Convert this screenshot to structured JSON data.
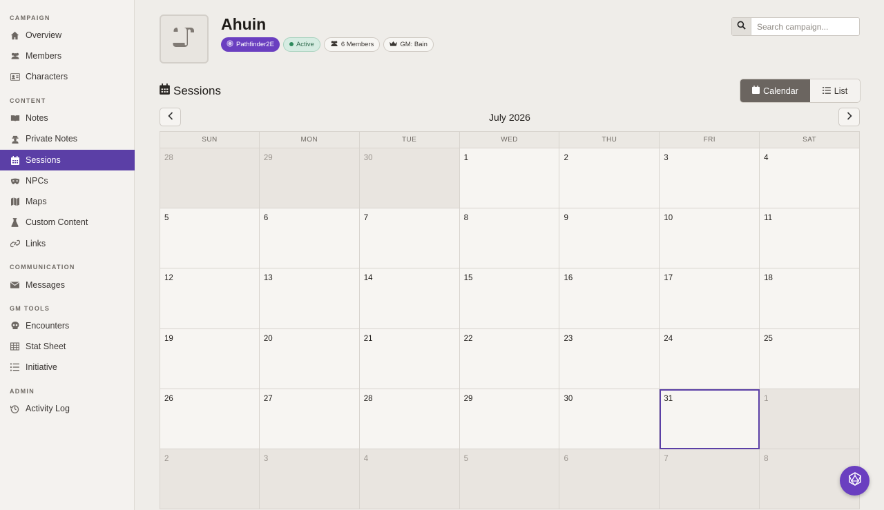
{
  "sidebar": {
    "sections": [
      {
        "title": "CAMPAIGN"
      },
      {
        "title": "CONTENT"
      },
      {
        "title": "COMMUNICATION"
      },
      {
        "title": "GM TOOLS"
      },
      {
        "title": "ADMIN"
      }
    ],
    "items": [
      {
        "label": "Overview",
        "icon": "home-icon"
      },
      {
        "label": "Members",
        "icon": "users-icon"
      },
      {
        "label": "Characters",
        "icon": "id-card-icon"
      },
      {
        "label": "Notes",
        "icon": "book-icon"
      },
      {
        "label": "Private Notes",
        "icon": "user-secret-icon"
      },
      {
        "label": "Sessions",
        "icon": "calendar-icon",
        "active": true
      },
      {
        "label": "NPCs",
        "icon": "mask-icon"
      },
      {
        "label": "Maps",
        "icon": "map-icon"
      },
      {
        "label": "Custom Content",
        "icon": "flask-icon"
      },
      {
        "label": "Links",
        "icon": "link-icon"
      },
      {
        "label": "Messages",
        "icon": "envelope-icon"
      },
      {
        "label": "Encounters",
        "icon": "skull-icon"
      },
      {
        "label": "Stat Sheet",
        "icon": "table-icon"
      },
      {
        "label": "Initiative",
        "icon": "list-ordered-icon"
      },
      {
        "label": "Activity Log",
        "icon": "history-icon"
      }
    ]
  },
  "header": {
    "title": "Ahuin",
    "badges": {
      "system": "Pathfinder2E",
      "status": "Active",
      "members": "6 Members",
      "gm": "GM: Bain"
    },
    "search_placeholder": "Search campaign..."
  },
  "sessions": {
    "title": "Sessions",
    "view_calendar": "Calendar",
    "view_list": "List",
    "month_label": "July 2026",
    "weekdays": [
      "SUN",
      "MON",
      "TUE",
      "WED",
      "THU",
      "FRI",
      "SAT"
    ],
    "weeks": [
      [
        "28",
        "29",
        "30",
        "1",
        "2",
        "3",
        "4"
      ],
      [
        "5",
        "6",
        "7",
        "8",
        "9",
        "10",
        "11"
      ],
      [
        "12",
        "13",
        "14",
        "15",
        "16",
        "17",
        "18"
      ],
      [
        "19",
        "20",
        "21",
        "22",
        "23",
        "24",
        "25"
      ],
      [
        "26",
        "27",
        "28",
        "29",
        "30",
        "31",
        "1"
      ],
      [
        "2",
        "3",
        "4",
        "5",
        "6",
        "7",
        "8"
      ]
    ]
  },
  "colors": {
    "accent": "#5b3fa6",
    "background": "#efede9",
    "status_green": "#2f6a4d"
  }
}
